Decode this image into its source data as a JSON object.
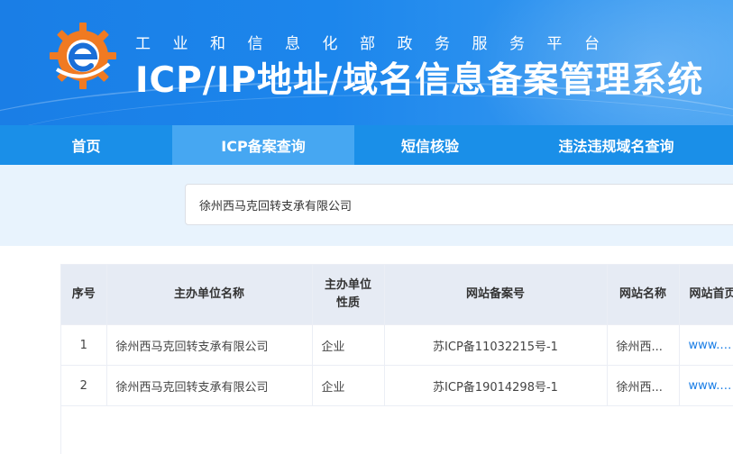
{
  "header": {
    "subtitle": "工业和信息化部政务服务平台",
    "title": "ICP/IP地址/域名信息备案管理系统"
  },
  "nav": {
    "items": [
      {
        "label": "首页",
        "active": false
      },
      {
        "label": "ICP备案查询",
        "active": true
      },
      {
        "label": "短信核验",
        "active": false
      },
      {
        "label": "违法违规域名查询",
        "active": false
      }
    ]
  },
  "search": {
    "value": "徐州西马克回转支承有限公司"
  },
  "table": {
    "columns": [
      "序号",
      "主办单位名称",
      "主办单位\n性质",
      "网站备案号",
      "网站名称",
      "网站首页"
    ],
    "rows": [
      {
        "index": "1",
        "org": "徐州西马克回转支承有限公司",
        "type": "企业",
        "icp": "苏ICP备11032215号-1",
        "site_name": "徐州西...",
        "homepage": "www.x..."
      },
      {
        "index": "2",
        "org": "徐州西马克回转支承有限公司",
        "type": "企业",
        "icp": "苏ICP备19014298号-1",
        "site_name": "徐州西...",
        "homepage": "www.x..."
      }
    ]
  },
  "colors": {
    "header_blue": "#1a7ee6",
    "nav_blue": "#1a8fe8",
    "nav_active": "#46a7f2",
    "logo_orange": "#f07a22",
    "link_blue": "#1a7ee6"
  },
  "icons": {
    "logo": "gear-e-logo-icon"
  }
}
